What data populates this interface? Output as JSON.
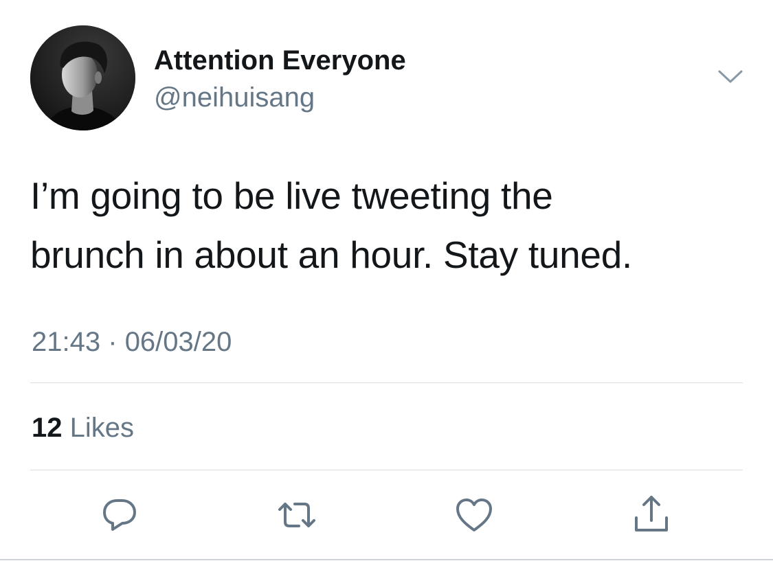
{
  "user": {
    "display_name": "Attention Everyone",
    "handle": "@neihuisang",
    "avatar_icon": "profile-photo"
  },
  "tweet": {
    "text_line1": "I’m going to be live tweeting the",
    "text_line2": "brunch in about an hour. Stay tuned.",
    "time": "21:43",
    "separator": "·",
    "date": "06/03/20"
  },
  "stats": {
    "likes_count": "12",
    "likes_label": "Likes"
  },
  "actions": {
    "reply_icon": "reply-icon",
    "retweet_icon": "retweet-icon",
    "like_icon": "heart-icon",
    "share_icon": "share-icon",
    "menu_icon": "chevron-down-icon"
  },
  "colors": {
    "text_primary": "#14171a",
    "text_secondary": "#657786",
    "divider": "#d8dde2",
    "icon": "#657786"
  }
}
